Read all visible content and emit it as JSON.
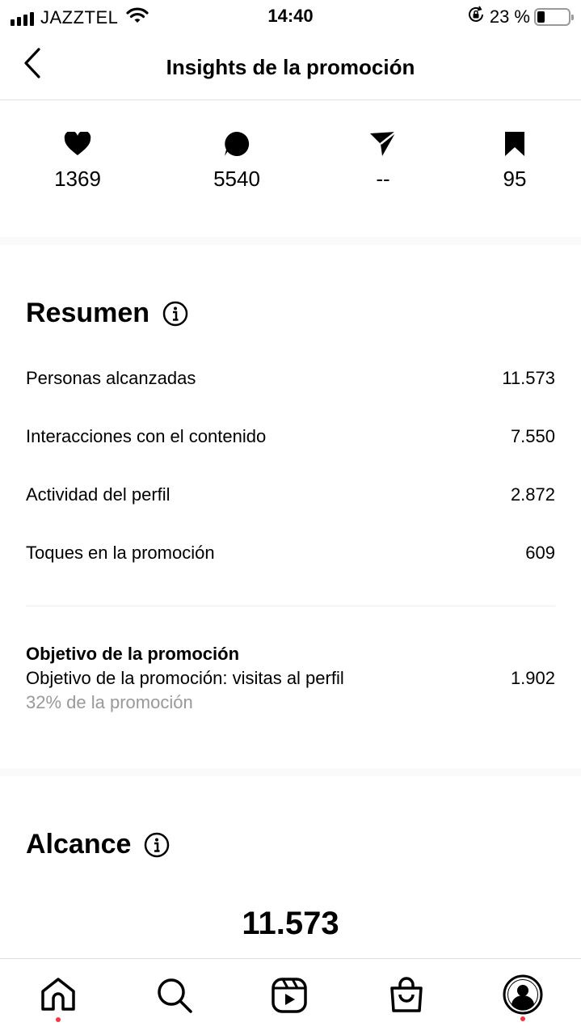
{
  "status_bar": {
    "carrier": "JAZZTEL",
    "time": "14:40",
    "battery_percent": "23 %",
    "battery_level": 0.23
  },
  "header": {
    "title": "Insights de la promoción",
    "back_icon": "chevron-left-icon"
  },
  "metrics": [
    {
      "icon": "heart-icon",
      "value": "1369"
    },
    {
      "icon": "comment-icon",
      "value": "5540"
    },
    {
      "icon": "send-icon",
      "value": "--"
    },
    {
      "icon": "bookmark-icon",
      "value": "95"
    }
  ],
  "summary": {
    "title": "Resumen",
    "rows": [
      {
        "label": "Personas alcanzadas",
        "value": "11.573"
      },
      {
        "label": "Interacciones con el contenido",
        "value": "7.550"
      },
      {
        "label": "Actividad del perfil",
        "value": "2.872"
      },
      {
        "label": "Toques en la promoción",
        "value": "609"
      }
    ],
    "goal": {
      "title": "Objetivo de la promoción",
      "label": "Objetivo de la promoción: visitas al perfil",
      "value": "1.902",
      "subtitle": "32% de la promoción"
    }
  },
  "reach": {
    "title": "Alcance",
    "value": "11.573"
  },
  "bottom_nav": [
    {
      "icon": "home-icon",
      "notification_dot": true
    },
    {
      "icon": "search-icon",
      "notification_dot": false
    },
    {
      "icon": "reels-icon",
      "notification_dot": false
    },
    {
      "icon": "shop-icon",
      "notification_dot": false
    },
    {
      "icon": "profile-icon",
      "notification_dot": true
    }
  ],
  "colors": {
    "text": "#000000",
    "muted": "#999999",
    "notification": "#ff3040",
    "divider": "#e0e0e0"
  }
}
